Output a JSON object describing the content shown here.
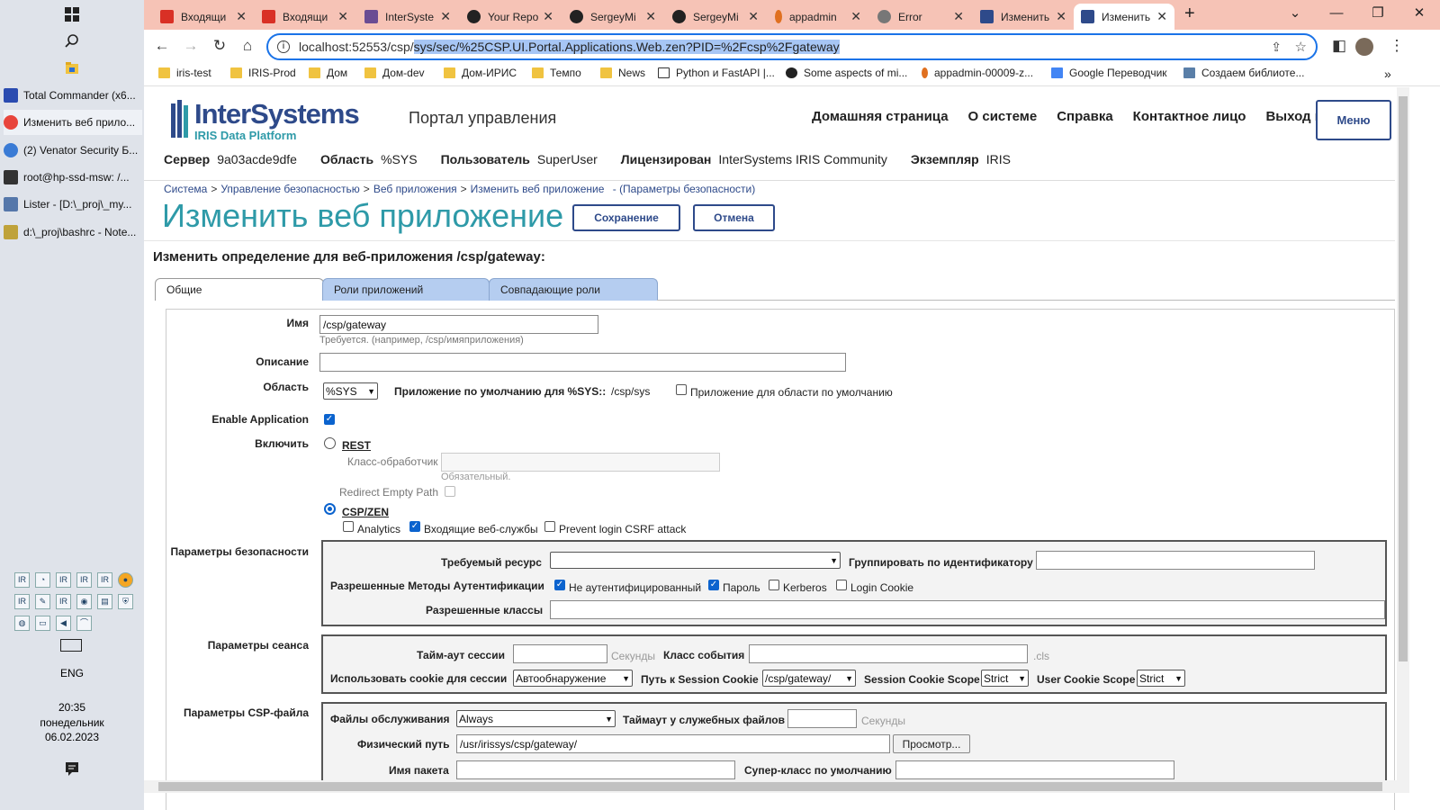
{
  "taskbar": {
    "apps": [
      {
        "label": "Total Commander (x6...",
        "color": "#2a4bb0"
      },
      {
        "label": "Изменить веб прило...",
        "color": "#e8453c"
      },
      {
        "label": "(2) Venator Security Б...",
        "color": "#3a7bd5"
      },
      {
        "label": "root@hp-ssd-msw: /...",
        "color": "#333333"
      },
      {
        "label": "Lister - [D:\\_proj\\_my...",
        "color": "#5577aa"
      },
      {
        "label": "d:\\_proj\\bashrc - Note...",
        "color": "#bfa23a"
      }
    ],
    "lang": "ENG",
    "time": "20:35",
    "day": "понедельник",
    "date": "06.02.2023"
  },
  "tabs": [
    {
      "title": "Входящи",
      "icon": "gmail-icon",
      "color": "#d93025"
    },
    {
      "title": "Входящи",
      "icon": "gmail-icon",
      "color": "#d93025"
    },
    {
      "title": "InterSyste",
      "icon": "intersystems-icon",
      "color": "#6a4c93"
    },
    {
      "title": "Your Repo",
      "icon": "github-icon",
      "color": "#222222"
    },
    {
      "title": "SergeyMi",
      "icon": "github-icon",
      "color": "#222222"
    },
    {
      "title": "SergeyMi",
      "icon": "github-icon",
      "color": "#222222"
    },
    {
      "title": "appadmin",
      "icon": "appadmin-icon",
      "color": "#e07020"
    },
    {
      "title": "Error",
      "icon": "globe-icon",
      "color": "#777777"
    },
    {
      "title": "Изменить",
      "icon": "iris-icon",
      "color": "#2e4a8a"
    },
    {
      "title": "Изменить",
      "icon": "iris-icon",
      "color": "#2e4a8a"
    }
  ],
  "omnibox": {
    "prefix": "localhost:52553/csp/",
    "selected": "sys/sec/%25CSP.UI.Portal.Applications.Web.zen?PID=%2Fcsp%2Fgateway"
  },
  "bookmarks": [
    "iris-test",
    "IRIS-Prod",
    "Дом",
    "Дом-dev",
    "Дом-ИРИС",
    "Темпо",
    "News",
    "Python и FastAPI |...",
    "Some aspects of mi...",
    "appadmin-00009-z...",
    "Google Переводчик",
    "Создаем библиоте..."
  ],
  "header": {
    "logo_name": "InterSystems",
    "logo_sub": "IRIS Data Platform",
    "portal_title": "Портал управления",
    "nav": [
      "Домашняя страница",
      "О системе",
      "Справка",
      "Контактное лицо",
      "Выход из"
    ],
    "menu": "Меню",
    "info": [
      {
        "label": "Сервер",
        "value": "9a03acde9dfe"
      },
      {
        "label": "Область",
        "value": "%SYS"
      },
      {
        "label": "Пользователь",
        "value": "SuperUser"
      },
      {
        "label": "Лицензирован",
        "value": "InterSystems IRIS Community"
      },
      {
        "label": "Экземпляр",
        "value": "IRIS"
      }
    ]
  },
  "breadcrumb": {
    "items": [
      "Система",
      "Управление безопасностью",
      "Веб приложения",
      "Изменить веб приложение"
    ],
    "suffix": "- (Параметры безопасности)"
  },
  "page": {
    "title": "Изменить веб приложение",
    "save": "Сохранение",
    "cancel": "Отмена",
    "form_heading": "Изменить определение для веб-приложения /csp/gateway:",
    "tabs": [
      "Общие",
      "Роли приложений",
      "Совпадающие роли"
    ]
  },
  "form": {
    "name_label": "Имя",
    "name_value": "/csp/gateway",
    "name_hint": "Требуется. (например, /csp/имяприложения)",
    "desc_label": "Описание",
    "desc_value": "",
    "ns_label": "Область",
    "ns_value": "%SYS",
    "default_app_label": "Приложение по умолчанию для %SYS::",
    "default_app_value": "/csp/sys",
    "default_ns_app": "Приложение для области по умолчанию",
    "enable_app_label": "Enable Application",
    "enable_label": "Включить",
    "rest": "REST",
    "dispatch_label": "Класс-обработчик",
    "dispatch_hint": "Обязательный.",
    "redirect_label": "Redirect Empty Path",
    "cspzen": "CSP/ZEN",
    "analytics": "Analytics",
    "inbound_ws": "Входящие веб-службы",
    "csrf": "Prevent login CSRF attack",
    "security": {
      "title": "Параметры безопасности",
      "resource_label": "Требуемый ресурс",
      "resource_value": "",
      "group_label": "Группировать по идентификатору",
      "auth_label": "Разрешенные Методы Аутентификации",
      "unauth": "Не аутентифицированный",
      "password": "Пароль",
      "kerberos": "Kerberos",
      "login_cookie": "Login Cookie",
      "classes_label": "Разрешенные классы"
    },
    "session": {
      "title": "Параметры сеанса",
      "timeout_label": "Тайм-аут сессии",
      "timeout_unit": "Секунды",
      "event_label": "Класс события",
      "event_ext": ".cls",
      "cookie_label": "Использовать cookie для сессии",
      "cookie_value": "Автообнаружение",
      "path_label": "Путь к Session Cookie",
      "path_value": "/csp/gateway/",
      "scope_label": "Session Cookie Scope",
      "scope_value": "Strict",
      "user_scope_label": "User Cookie Scope",
      "user_scope_value": "Strict"
    },
    "cspfile": {
      "title": "Параметры CSP-файла",
      "serve_label": "Файлы обслуживания",
      "serve_value": "Always",
      "timeout_label": "Таймаут у служебных файлов",
      "timeout_unit": "Секунды",
      "path_label": "Физический путь",
      "path_value": "/usr/irissys/csp/gateway/",
      "browse": "Просмотр...",
      "package_label": "Имя пакета",
      "superclass_label": "Супер-класс по умолчанию"
    }
  }
}
